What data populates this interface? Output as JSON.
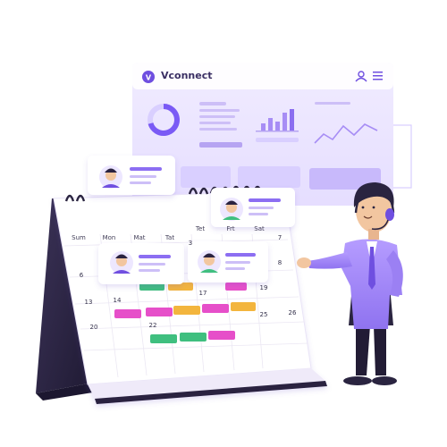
{
  "app": {
    "brand_name": "Vconnect",
    "brand_initial": "V",
    "icons": [
      "user-icon",
      "menu-icon"
    ]
  },
  "calendar": {
    "weekdays": [
      "Sum",
      "Mon",
      "Mat",
      "Tat",
      "Tet",
      "Frt",
      "Sat"
    ],
    "row2": [
      "6",
      "",
      "",
      "",
      "17",
      "",
      "19"
    ],
    "row3": [
      "13",
      "14",
      "",
      "",
      "",
      "25",
      "26"
    ],
    "row4": [
      "20",
      "",
      "22",
      "",
      "",
      "",
      ""
    ],
    "extra": [
      "3",
      "7",
      "8"
    ]
  },
  "colors": {
    "accent": "#7a5af5",
    "pink": "#e64fc9",
    "green": "#3fbf7f",
    "orange": "#f3b53d",
    "dark": "#2a2440"
  }
}
